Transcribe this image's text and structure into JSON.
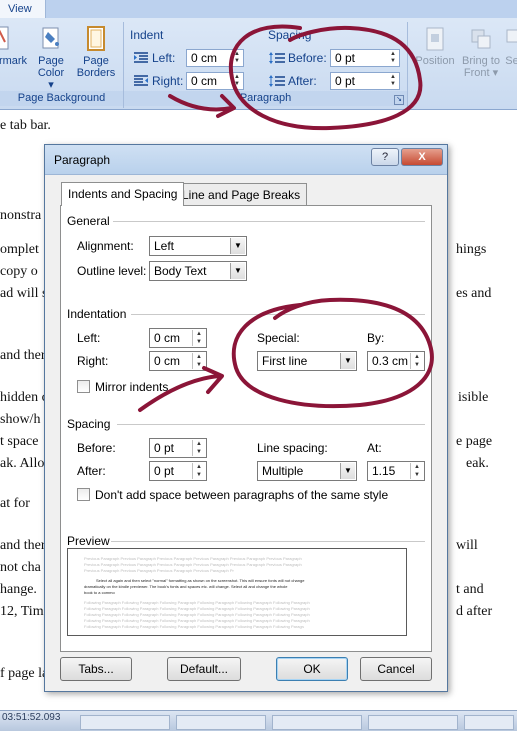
{
  "ribbon": {
    "tab_label": "View",
    "page_bg_group": {
      "watermark_label": "rmark",
      "page_color_line1": "Page",
      "page_color_line2": "Color ▾",
      "page_borders_line1": "Page",
      "page_borders_line2": "Borders",
      "group_label": "Page Background"
    },
    "paragraph_group": {
      "indent_title": "Indent",
      "left_label": "Left:",
      "left_value": "0 cm",
      "right_label": "Right:",
      "right_value": "0 cm",
      "spacing_title": "Spacing",
      "before_label": "Before:",
      "before_value": "0 pt",
      "after_label": "After:",
      "after_value": "0 pt",
      "group_label": "Paragraph"
    },
    "arrange_group": {
      "position_label": "Position",
      "bring_to_front_line1": "Bring to",
      "bring_to_front_line2": "Front ▾",
      "send_label": "Se"
    }
  },
  "document": {
    "lines": [
      "e tab bar.",
      "nonstra",
      "omplet",
      "hings",
      "copy o",
      "ad will s",
      "es and",
      "and ther",
      "hidden c",
      "isible",
      "show/h",
      "t space",
      "e page",
      "ak. Allo",
      "eak.",
      "at for",
      "and ther",
      "will",
      "not cha",
      "hange.",
      "t and",
      "12, Tim",
      "d after",
      "f page la"
    ]
  },
  "status_bar": {
    "text": "03:51:52.093"
  },
  "dialog": {
    "title": "Paragraph",
    "help_label": "?",
    "close_label": "X",
    "tabs": [
      {
        "label": "Indents and Spacing"
      },
      {
        "label": "Line and Page Breaks"
      }
    ],
    "general": {
      "title": "General",
      "alignment_label": "Alignment:",
      "alignment_value": "Left",
      "outline_label": "Outline level:",
      "outline_value": "Body Text"
    },
    "indentation": {
      "title": "Indentation",
      "left_label": "Left:",
      "left_value": "0 cm",
      "right_label": "Right:",
      "right_value": "0 cm",
      "special_label": "Special:",
      "special_value": "First line",
      "by_label": "By:",
      "by_value": "0.3 cm",
      "mirror_label": "Mirror indents"
    },
    "spacing": {
      "title": "Spacing",
      "before_label": "Before:",
      "before_value": "0 pt",
      "after_label": "After:",
      "after_value": "0 pt",
      "line_spacing_label": "Line spacing:",
      "line_spacing_value": "Multiple",
      "at_label": "At:",
      "at_value": "1.15",
      "dont_add_label": "Don't add space between paragraphs of the same style"
    },
    "preview": {
      "title": "Preview",
      "prev_text": "Previous Paragraph Previous Paragraph Previous Paragraph Previous Paragraph Previous Paragraph Previous Paragraph",
      "sample_1": "Select all again and then select \"normal\" formatting as shown on the screenshot. This will ensure fonts will not change",
      "sample_2": "dramatically on the kindle previewer. The book's fonts and spaces etc. will change. Select all and change the whole",
      "sample_3": "book to a commo",
      "next_text": "Following Paragraph Following Paragraph Following Paragraph Following Paragraph Following Paragraph Following Paragraph"
    },
    "buttons": {
      "tabs": "Tabs...",
      "default": "Default...",
      "ok": "OK",
      "cancel": "Cancel"
    }
  },
  "colors": {
    "annotation": "#8b1538",
    "ribbon_text": "#15428b"
  }
}
